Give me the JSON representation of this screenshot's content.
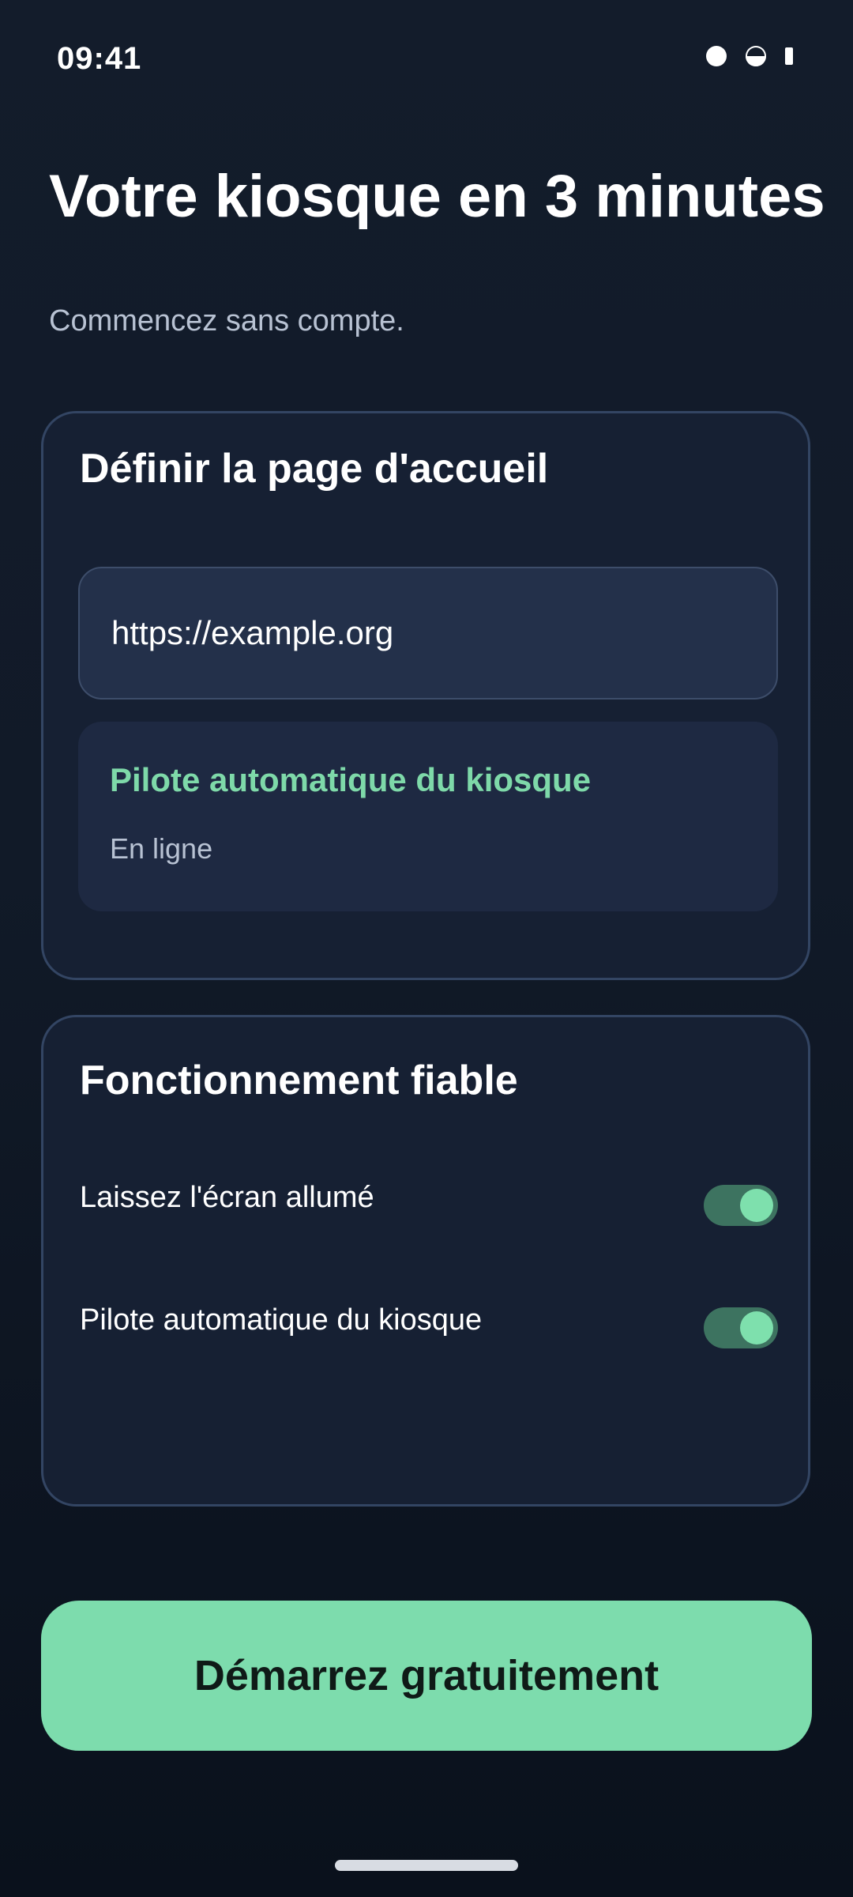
{
  "status_bar": {
    "time": "09:41",
    "icons": [
      "signal-dot-icon",
      "half-circle-icon",
      "battery-icon"
    ]
  },
  "header": {
    "title": "Votre kiosque en 3 minutes",
    "subtitle": "Commencez sans compte."
  },
  "homepage_card": {
    "title": "Définir la page d'accueil",
    "url_value": "https://example.org",
    "autopilot": {
      "title": "Pilote automatique du kiosque",
      "status": "En ligne"
    }
  },
  "reliable_card": {
    "title": "Fonctionnement fiable",
    "settings": [
      {
        "label": "Laissez l'écran allumé",
        "enabled": true
      },
      {
        "label": "Pilote automatique du kiosque",
        "enabled": true
      }
    ]
  },
  "cta": {
    "label": "Démarrez gratuitement"
  },
  "colors": {
    "accent": "#7ddcad",
    "background": "#121b29",
    "card": "#162033",
    "toggle_track": "#3d7360"
  }
}
